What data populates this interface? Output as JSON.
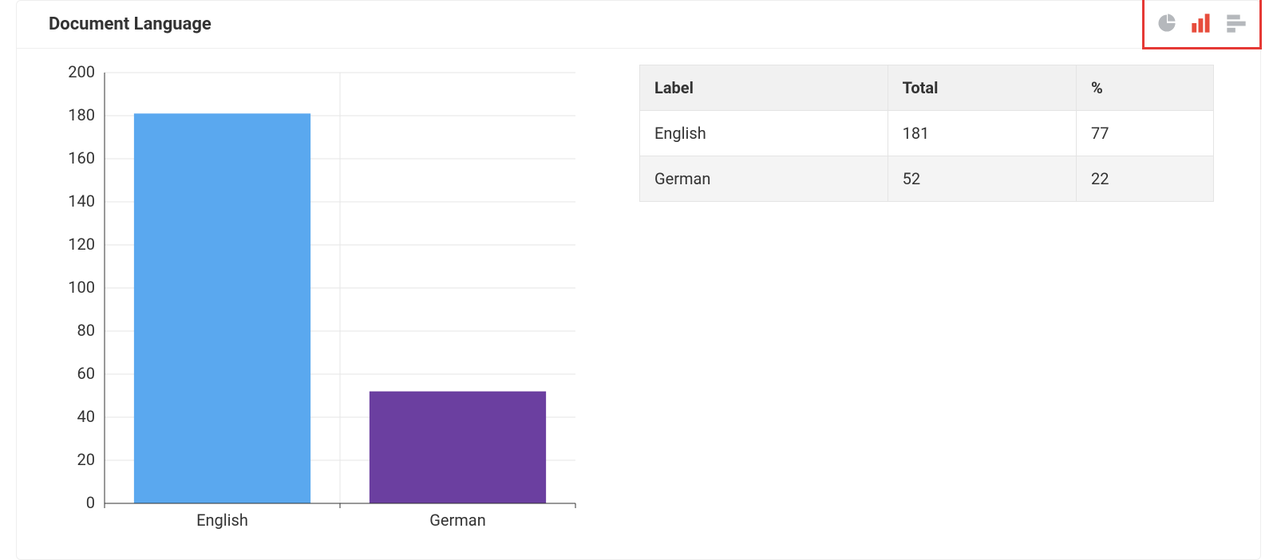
{
  "panel": {
    "title": "Document Language"
  },
  "switcher": {
    "pie_active": false,
    "bar_active": true,
    "hbar_active": false,
    "active_color": "#e74c3c",
    "inactive_color": "#b5b8bc",
    "highlight_border": "#e53935"
  },
  "table": {
    "headers": {
      "label": "Label",
      "total": "Total",
      "pct": "%"
    },
    "rows": [
      {
        "label": "English",
        "total": "181",
        "pct": "77"
      },
      {
        "label": "German",
        "total": "52",
        "pct": "22"
      }
    ]
  },
  "chart_data": {
    "type": "bar",
    "title": "",
    "xlabel": "",
    "ylabel": "",
    "categories": [
      "English",
      "German"
    ],
    "values": [
      181,
      52
    ],
    "series": [
      {
        "name": "English",
        "value": 181,
        "color": "#5aa8ef"
      },
      {
        "name": "German",
        "value": 52,
        "color": "#6b3fa0"
      }
    ],
    "y_ticks": [
      0,
      20,
      40,
      60,
      80,
      100,
      120,
      140,
      160,
      180,
      200
    ],
    "ylim": [
      0,
      200
    ],
    "grid": true,
    "legend": false
  }
}
